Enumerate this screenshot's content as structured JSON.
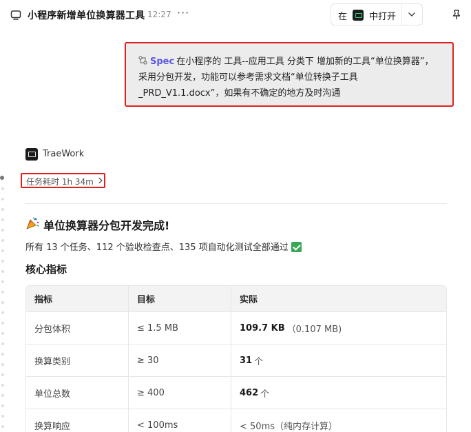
{
  "header": {
    "title": "小程序新增单位换算器工具",
    "time": "12:27",
    "more": "···",
    "open_in_prefix": "在",
    "open_in_suffix": "中打开"
  },
  "user_message": {
    "spec_label": "Spec",
    "text": "在小程序的 工具--应用工具 分类下 增加新的工具“单位换算器”，采用分包开发，功能可以参考需求文档“单位转换子工具_PRD_V1.1.docx”，如果有不确定的地方及时沟通"
  },
  "assistant": {
    "name": "TraeWork",
    "duration": "任务耗时 1h 34m",
    "done_title": "单位换算器分包开发完成!",
    "summary": "所有 13 个任务、112 个验收检查点、135 项自动化测试全部通过",
    "section_title": "核心指标",
    "table": {
      "headers": [
        "指标",
        "目标",
        "实际"
      ],
      "rows": [
        {
          "metric": "分包体积",
          "target": "≤ 1.5 MB",
          "actual_strong": "109.7 KB",
          "actual_rest": "（0.107 MB)"
        },
        {
          "metric": "换算类别",
          "target": "≥ 30",
          "actual_strong": "31",
          "actual_rest": "个"
        },
        {
          "metric": "单位总数",
          "target": "≥ 400",
          "actual_strong": "462",
          "actual_rest": "个"
        },
        {
          "metric": "换算响应",
          "target": "< 100ms",
          "actual_strong": "",
          "actual_rest": "< 50ms（纯内存计算）"
        }
      ]
    }
  },
  "colors": {
    "accent": "#5b57e0",
    "highlight_border": "#e02020",
    "success": "#3aa757"
  }
}
